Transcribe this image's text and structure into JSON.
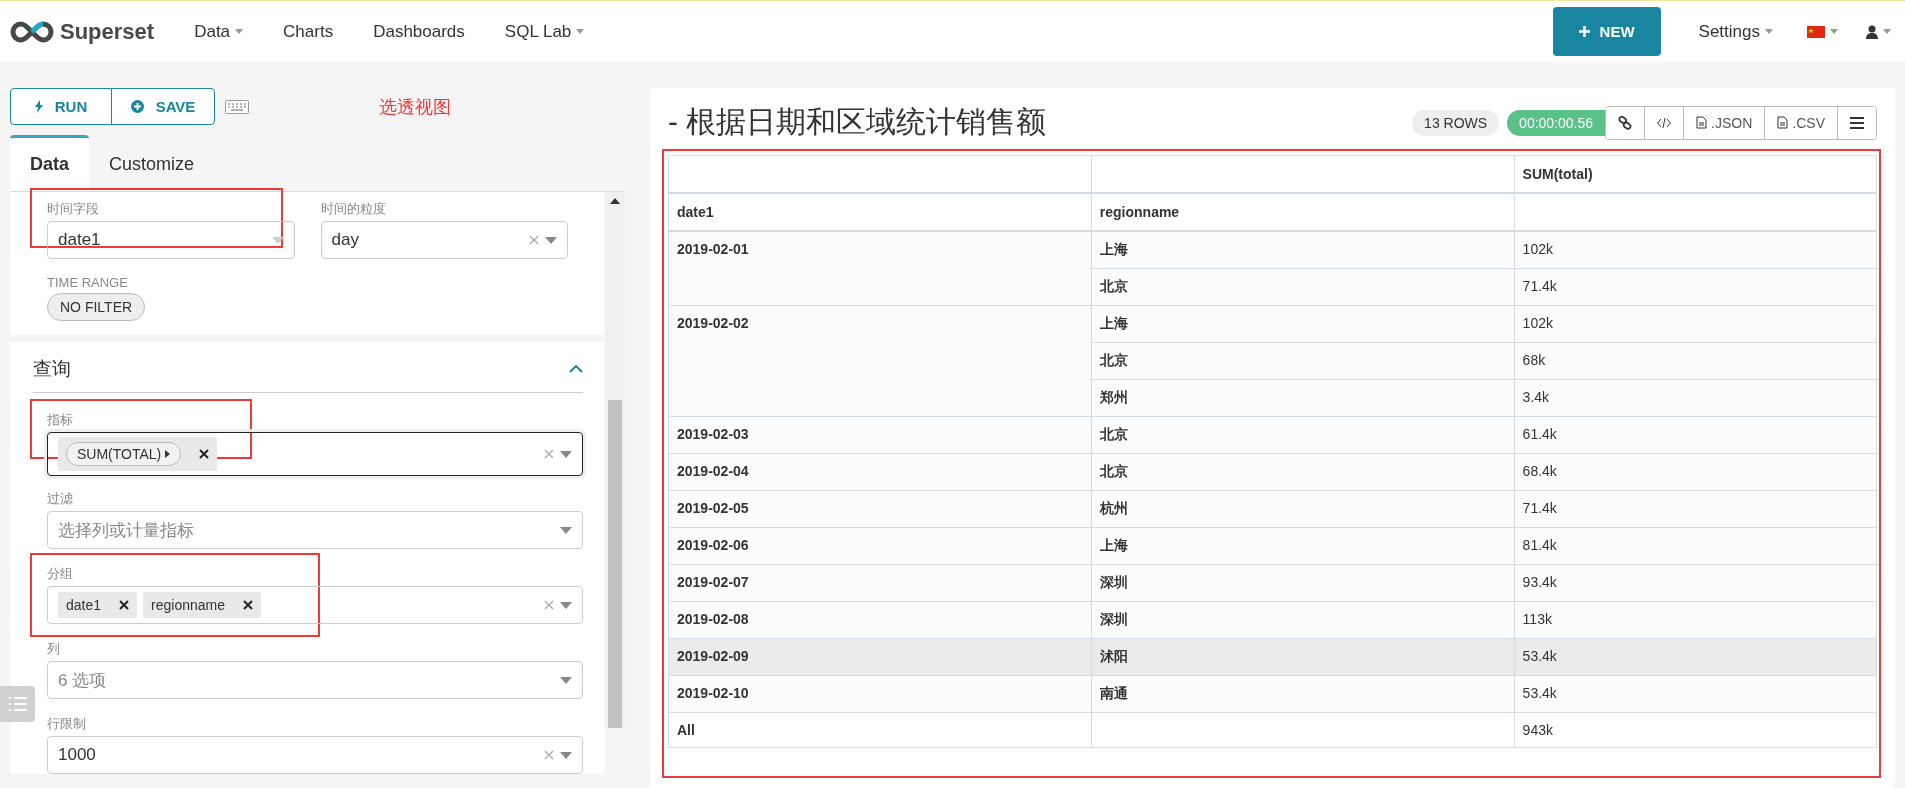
{
  "nav": {
    "brand": "Superset",
    "items": [
      {
        "label": "Data",
        "dropdown": true
      },
      {
        "label": "Charts",
        "dropdown": false
      },
      {
        "label": "Dashboards",
        "dropdown": false
      },
      {
        "label": "SQL Lab",
        "dropdown": true
      }
    ],
    "new_button": "NEW",
    "settings": "Settings"
  },
  "toolbar": {
    "run": "RUN",
    "save": "SAVE",
    "annotation": "选透视图"
  },
  "tabs": [
    {
      "label": "Data",
      "selected": true
    },
    {
      "label": "Customize",
      "selected": false
    }
  ],
  "time_controls": [
    {
      "label": "时间字段",
      "value": "date1",
      "clearable": false,
      "annotated": true
    },
    {
      "label": "时间的粒度",
      "value": "day",
      "clearable": true,
      "annotated": false
    }
  ],
  "time_range": {
    "label": "TIME RANGE",
    "value": "NO FILTER"
  },
  "query": {
    "title": "查询",
    "expanded": true,
    "controls": [
      {
        "kind": "metric",
        "label": "指标",
        "tags": [
          "SUM(TOTAL)"
        ],
        "clearable": true,
        "focused": true,
        "annotated": true
      },
      {
        "kind": "select",
        "label": "过滤",
        "placeholder": "选择列或计量指标",
        "clearable": false,
        "focused": false,
        "annotated": false
      },
      {
        "kind": "tags",
        "label": "分组",
        "tags": [
          "date1",
          "regionname"
        ],
        "clearable": true,
        "focused": false,
        "annotated": true
      },
      {
        "kind": "select",
        "label": "列",
        "placeholder": "6 选项",
        "clearable": false,
        "focused": false,
        "annotated": false
      },
      {
        "kind": "select",
        "label": "行限制",
        "value": "1000",
        "clearable": true,
        "focused": false,
        "annotated": false
      }
    ]
  },
  "chart": {
    "title": "- 根据日期和区域统计销售额",
    "rows_badge": "13 ROWS",
    "timer": "00:00:00.56",
    "actions": [
      {
        "kind": "link"
      },
      {
        "kind": "code"
      },
      {
        "kind": "file",
        "label": ".JSON"
      },
      {
        "kind": "file",
        "label": ".CSV"
      },
      {
        "kind": "menu"
      }
    ],
    "annotated": true
  },
  "table": {
    "header_rows": [
      [
        "",
        "",
        "SUM(total)"
      ],
      [
        "date1",
        "regionname",
        ""
      ]
    ],
    "groups": [
      {
        "date": "2019-02-01",
        "rows": [
          {
            "region": "上海",
            "value": "102k",
            "highlighted": false
          },
          {
            "region": "北京",
            "value": "71.4k",
            "highlighted": false
          }
        ]
      },
      {
        "date": "2019-02-02",
        "rows": [
          {
            "region": "上海",
            "value": "102k",
            "highlighted": false
          },
          {
            "region": "北京",
            "value": "68k",
            "highlighted": false
          },
          {
            "region": "郑州",
            "value": "3.4k",
            "highlighted": false
          }
        ]
      },
      {
        "date": "2019-02-03",
        "rows": [
          {
            "region": "北京",
            "value": "61.4k",
            "highlighted": false
          }
        ]
      },
      {
        "date": "2019-02-04",
        "rows": [
          {
            "region": "北京",
            "value": "68.4k",
            "highlighted": false
          }
        ]
      },
      {
        "date": "2019-02-05",
        "rows": [
          {
            "region": "杭州",
            "value": "71.4k",
            "highlighted": false
          }
        ]
      },
      {
        "date": "2019-02-06",
        "rows": [
          {
            "region": "上海",
            "value": "81.4k",
            "highlighted": false
          }
        ]
      },
      {
        "date": "2019-02-07",
        "rows": [
          {
            "region": "深圳",
            "value": "93.4k",
            "highlighted": false
          }
        ]
      },
      {
        "date": "2019-02-08",
        "rows": [
          {
            "region": "深圳",
            "value": "113k",
            "highlighted": false
          }
        ]
      },
      {
        "date": "2019-02-09",
        "rows": [
          {
            "region": "沭阳",
            "value": "53.4k",
            "highlighted": true
          }
        ]
      },
      {
        "date": "2019-02-10",
        "rows": [
          {
            "region": "南通",
            "value": "53.4k",
            "highlighted": false
          }
        ]
      }
    ],
    "total": {
      "label": "All",
      "value": "943k"
    }
  }
}
